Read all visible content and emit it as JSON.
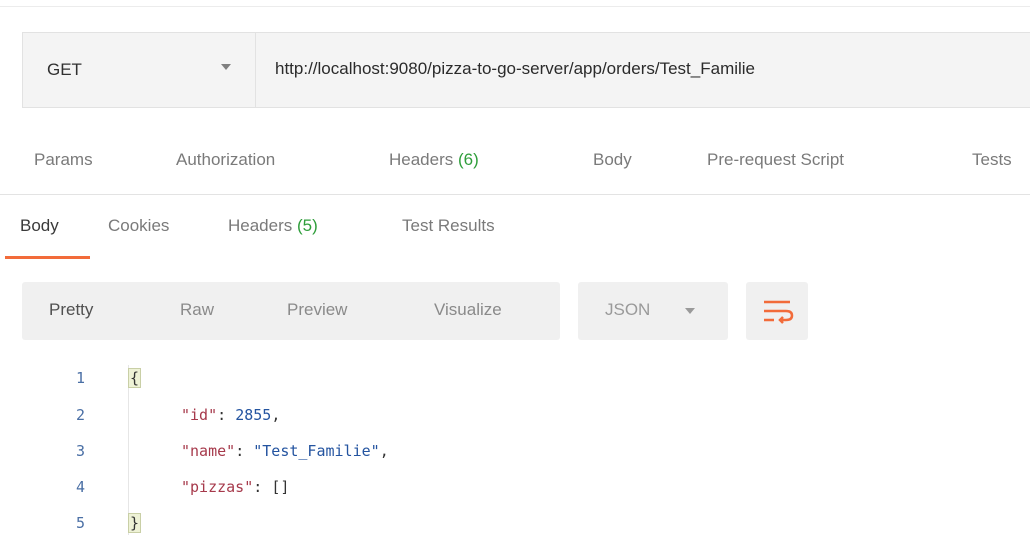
{
  "request": {
    "method": "GET",
    "url": "http://localhost:9080/pizza-to-go-server/app/orders/Test_Familie"
  },
  "request_tabs": {
    "params": "Params",
    "authorization": "Authorization",
    "headers": "Headers",
    "headers_count": "(6)",
    "body": "Body",
    "prerequest": "Pre-request Script",
    "tests": "Tests"
  },
  "response_tabs": {
    "body": "Body",
    "cookies": "Cookies",
    "headers": "Headers",
    "headers_count": "(5)",
    "test_results": "Test Results"
  },
  "format": {
    "pretty": "Pretty",
    "raw": "Raw",
    "preview": "Preview",
    "visualize": "Visualize",
    "language": "JSON",
    "wrap_icon": "wrap-lines-icon"
  },
  "code": {
    "line_numbers": [
      "1",
      "2",
      "3",
      "4",
      "5"
    ],
    "open_brace": "{",
    "close_brace": "}",
    "lines": [
      {
        "key": "\"id\"",
        "sep": ": ",
        "value": "2855",
        "trail": ","
      },
      {
        "key": "\"name\"",
        "sep": ": ",
        "value": "\"Test_Familie\"",
        "trail": ","
      },
      {
        "key": "\"pizzas\"",
        "sep": ": ",
        "value": "[]",
        "trail": ""
      }
    ]
  },
  "colors": {
    "accent": "#f26b3a",
    "count_green": "#2f9e3b",
    "json_key": "#a6394b",
    "json_value": "#2454a0"
  }
}
